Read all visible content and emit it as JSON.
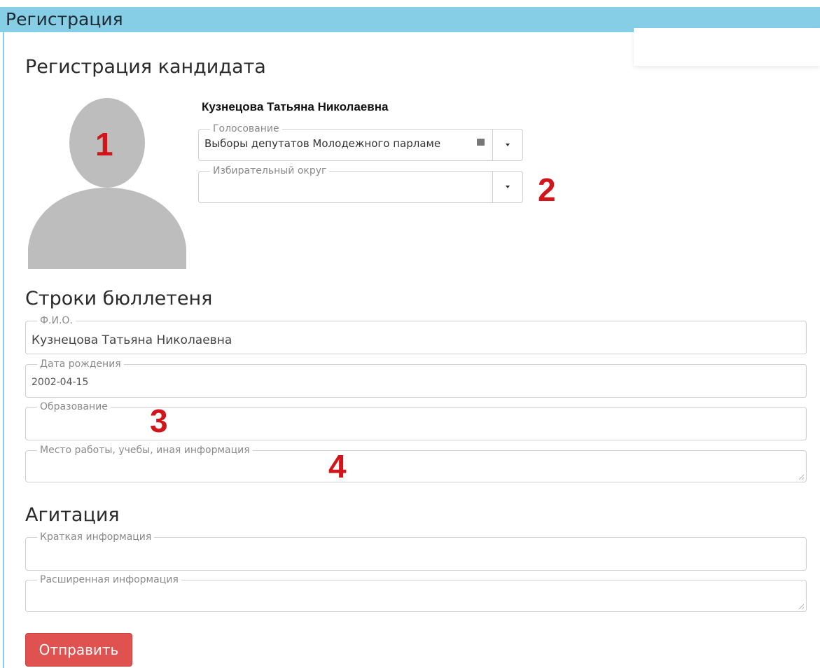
{
  "header": {
    "title": "Регистрация"
  },
  "candidate_section": {
    "title": "Регистрация кандидата",
    "candidate_name": "Кузнецова Татьяна Николаевна",
    "voting": {
      "legend": "Голосование",
      "value": "Выборы депутатов Молодежного парламе"
    },
    "district": {
      "legend": "Избирательный округ",
      "value": ""
    }
  },
  "ballot_section": {
    "title": "Строки бюллетеня",
    "fio": {
      "legend": "Ф.И.О.",
      "value": "Кузнецова Татьяна Николаевна"
    },
    "birthdate": {
      "legend": "Дата рождения",
      "value": "2002-04-15"
    },
    "education": {
      "legend": "Образование",
      "value": ""
    },
    "workplace": {
      "legend": "Место работы, учебы, иная информация",
      "value": ""
    }
  },
  "agitation_section": {
    "title": "Агитация",
    "short_info": {
      "legend": "Краткая информация",
      "value": ""
    },
    "extended_info": {
      "legend": "Расширенная информация",
      "value": ""
    }
  },
  "markers": [
    "1",
    "2",
    "3",
    "4"
  ],
  "submit_label": "Отправить",
  "colors": {
    "header_bg": "#86cde6",
    "submit_bg": "#e0524f",
    "marker": "#d0161b",
    "avatar": "#bdbdbd"
  }
}
